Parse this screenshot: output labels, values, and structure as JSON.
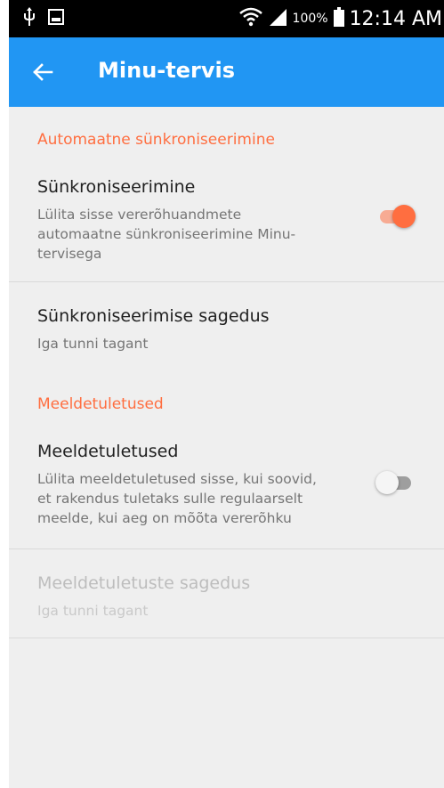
{
  "status_bar": {
    "battery_percent": "100%",
    "time": "12:14 AM",
    "icons": [
      "usb-icon",
      "gallery-icon",
      "wifi-icon",
      "signal-icon",
      "battery-icon"
    ]
  },
  "app_bar": {
    "title": "Minu-tervis",
    "back_icon": "arrow-back-icon"
  },
  "sections": [
    {
      "header": "Automaatne sünkroniseerimine",
      "sync": {
        "title": "Sünkroniseerimine",
        "summary_lines": [
          "Lülita sisse vererõhuandmete",
          "automaatne sünkroniseerimine Minu-",
          "tervisega"
        ],
        "enabled": true
      },
      "frequency": {
        "title": "Sünkroniseerimise sagedus",
        "summary": "Iga tunni tagant"
      }
    },
    {
      "header": "Meeldetuletused",
      "reminders": {
        "title": "Meeldetuletused",
        "summary_lines": [
          "Lülita meeldetuletused sisse, kui soovid,",
          "et rakendus tuletaks sulle regulaarselt",
          "meelde, kui aeg on mõõta vererõhku"
        ],
        "enabled": false
      },
      "frequency": {
        "title": "Meeldetuletuste sagedus",
        "summary": "Iga tunni tagant",
        "disabled": true
      }
    }
  ],
  "colors": {
    "accent": "#ff6e40",
    "app_bar": "#2196f3",
    "background": "#efefef"
  }
}
